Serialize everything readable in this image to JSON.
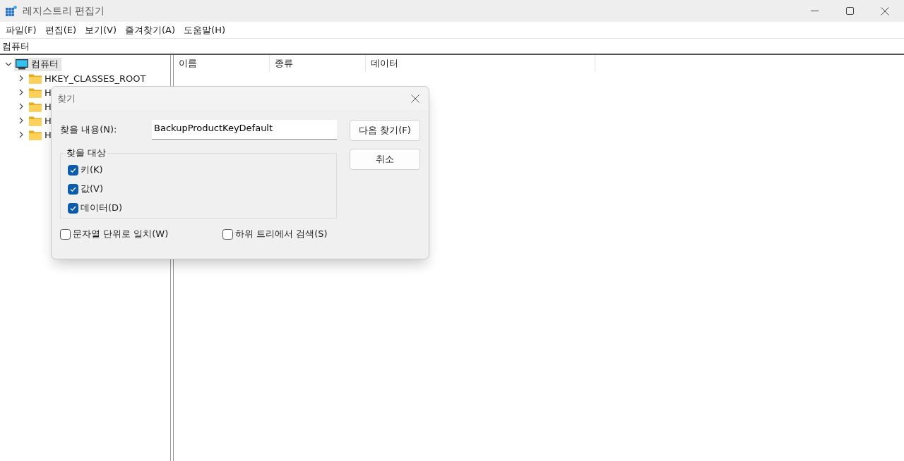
{
  "window": {
    "title": "레지스트리 편집기"
  },
  "menu": [
    "파일(F)",
    "편집(E)",
    "보기(V)",
    "즐겨찾기(A)",
    "도움말(H)"
  ],
  "address": "컴퓨터",
  "tree": {
    "label": "컴퓨터",
    "selected": true,
    "expanded": true,
    "children": [
      {
        "label": "HKEY_CLASSES_ROOT",
        "expanded": false
      },
      {
        "label": "H",
        "expanded": false
      },
      {
        "label": "H",
        "expanded": false
      },
      {
        "label": "H",
        "expanded": false
      },
      {
        "label": "H",
        "expanded": false
      }
    ]
  },
  "list": {
    "columns": [
      "이름",
      "종류",
      "데이터"
    ]
  },
  "find_dialog": {
    "title": "찾기",
    "find_label": "찾을 내용(N):",
    "find_value": "BackupProductKeyDefault",
    "buttons": [
      "다음 찾기(F)",
      "취소"
    ],
    "group_title": "찾을 대상",
    "targets": [
      {
        "label": "키(K)",
        "checked": true
      },
      {
        "label": "값(V)",
        "checked": true
      },
      {
        "label": "데이터(D)",
        "checked": true
      }
    ],
    "options": [
      {
        "label": "문자열 단위로 일치(W)",
        "checked": false
      },
      {
        "label": "하위 트리에서 검색(S)",
        "checked": false
      }
    ]
  }
}
